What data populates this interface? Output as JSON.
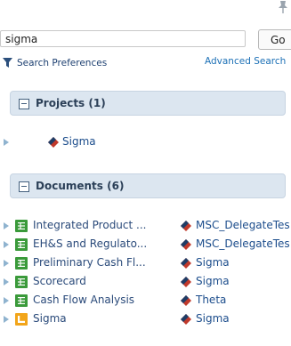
{
  "search": {
    "value": "sigma",
    "go_label": "Go"
  },
  "preferences": {
    "label": "Search Preferences",
    "advanced_label": "Advanced Search"
  },
  "projects": {
    "header": "Projects (1)",
    "items": [
      {
        "name": "Sigma",
        "icon": "project-icon"
      }
    ]
  },
  "documents": {
    "header": "Documents (6)",
    "items": [
      {
        "name": "Integrated Product ...",
        "icon": "scorecard-icon",
        "project": "MSC_DelegateTes"
      },
      {
        "name": "EH&S and Regulato...",
        "icon": "scorecard-icon",
        "project": "MSC_DelegateTes"
      },
      {
        "name": "Preliminary Cash Fl...",
        "icon": "scorecard-icon",
        "project": "Sigma"
      },
      {
        "name": "Scorecard",
        "icon": "scorecard-icon",
        "project": "Sigma"
      },
      {
        "name": "Cash Flow Analysis",
        "icon": "scorecard-icon",
        "project": "Theta"
      },
      {
        "name": "Sigma",
        "icon": "chart-doc-icon",
        "project": "Sigma"
      }
    ]
  }
}
